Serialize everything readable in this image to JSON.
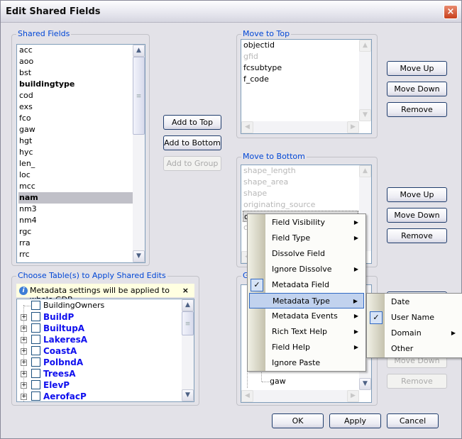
{
  "window": {
    "title": "Edit Shared Fields",
    "close": "×"
  },
  "shared_fields": {
    "label": "Shared Fields",
    "items": [
      {
        "text": "acc"
      },
      {
        "text": "aoo"
      },
      {
        "text": "bst"
      },
      {
        "text": "buildingtype",
        "bold": true
      },
      {
        "text": "cod"
      },
      {
        "text": "exs"
      },
      {
        "text": "fco"
      },
      {
        "text": "gaw"
      },
      {
        "text": "hgt"
      },
      {
        "text": "hyc"
      },
      {
        "text": "len_"
      },
      {
        "text": "loc"
      },
      {
        "text": "mcc"
      },
      {
        "text": "nam",
        "bold": true,
        "selected": true
      },
      {
        "text": "nm3"
      },
      {
        "text": "nm4"
      },
      {
        "text": "rgc"
      },
      {
        "text": "rra"
      },
      {
        "text": "rrc"
      }
    ]
  },
  "middle_buttons": {
    "add_top": "Add to Top",
    "add_bottom": "Add to Bottom",
    "add_group": "Add to Group"
  },
  "move_to_top": {
    "label": "Move to Top",
    "items": [
      {
        "text": "objectid"
      },
      {
        "text": "gfid",
        "disabled": true
      },
      {
        "text": "fcsubtype"
      },
      {
        "text": "f_code"
      }
    ]
  },
  "move_to_bottom": {
    "label": "Move to Bottom",
    "items": [
      {
        "text": "shape_length",
        "disabled": true
      },
      {
        "text": "shape_area",
        "disabled": true
      },
      {
        "text": "shape",
        "disabled": true
      },
      {
        "text": "originating_source",
        "disabled": true
      },
      {
        "text": "o",
        "selected": true
      },
      {
        "text": "c",
        "disabled": true
      }
    ]
  },
  "group": {
    "label": "G",
    "items": [
      "gaw"
    ]
  },
  "buttons": {
    "move_up": "Move Up",
    "move_down": "Move Down",
    "remove": "Remove"
  },
  "tables": {
    "label": "Choose Table(s) to Apply Shared Edits",
    "info": "Metadata settings will be applied to whole GDB",
    "info_close": "×",
    "items": [
      {
        "text": "BuildingOwners",
        "expandable": false
      },
      {
        "text": "BuildP",
        "expandable": true
      },
      {
        "text": "BuiltupA",
        "expandable": true
      },
      {
        "text": "LakeresA",
        "expandable": true
      },
      {
        "text": "CoastA",
        "expandable": true
      },
      {
        "text": "PolbndA",
        "expandable": true
      },
      {
        "text": "TreesA",
        "expandable": true
      },
      {
        "text": "ElevP",
        "expandable": true
      },
      {
        "text": "AerofacP",
        "expandable": true
      }
    ]
  },
  "context_menu": {
    "items": [
      {
        "text": "Field Visibility",
        "submenu": true
      },
      {
        "text": "Field Type",
        "submenu": true
      },
      {
        "text": "Dissolve Field"
      },
      {
        "text": "Ignore Dissolve",
        "submenu": true
      },
      {
        "text": "Metadata Field",
        "checked": true
      },
      {
        "text": "Metadata Type",
        "submenu": true,
        "highlighted": true
      },
      {
        "text": "Metadata Events",
        "submenu": true
      },
      {
        "text": "Rich Text Help",
        "submenu": true
      },
      {
        "text": "Field Help",
        "submenu": true
      },
      {
        "text": "Ignore Paste"
      }
    ]
  },
  "submenu": {
    "items": [
      {
        "text": "Date"
      },
      {
        "text": "User Name",
        "checked": true
      },
      {
        "text": "Domain",
        "submenu": true
      },
      {
        "text": "Other"
      }
    ]
  },
  "footer": {
    "ok": "OK",
    "apply": "Apply",
    "cancel": "Cancel"
  },
  "colors": {
    "accent": "#0046d5",
    "table_link": "#1010ee",
    "menu_highlight": "#c1d2ee"
  }
}
